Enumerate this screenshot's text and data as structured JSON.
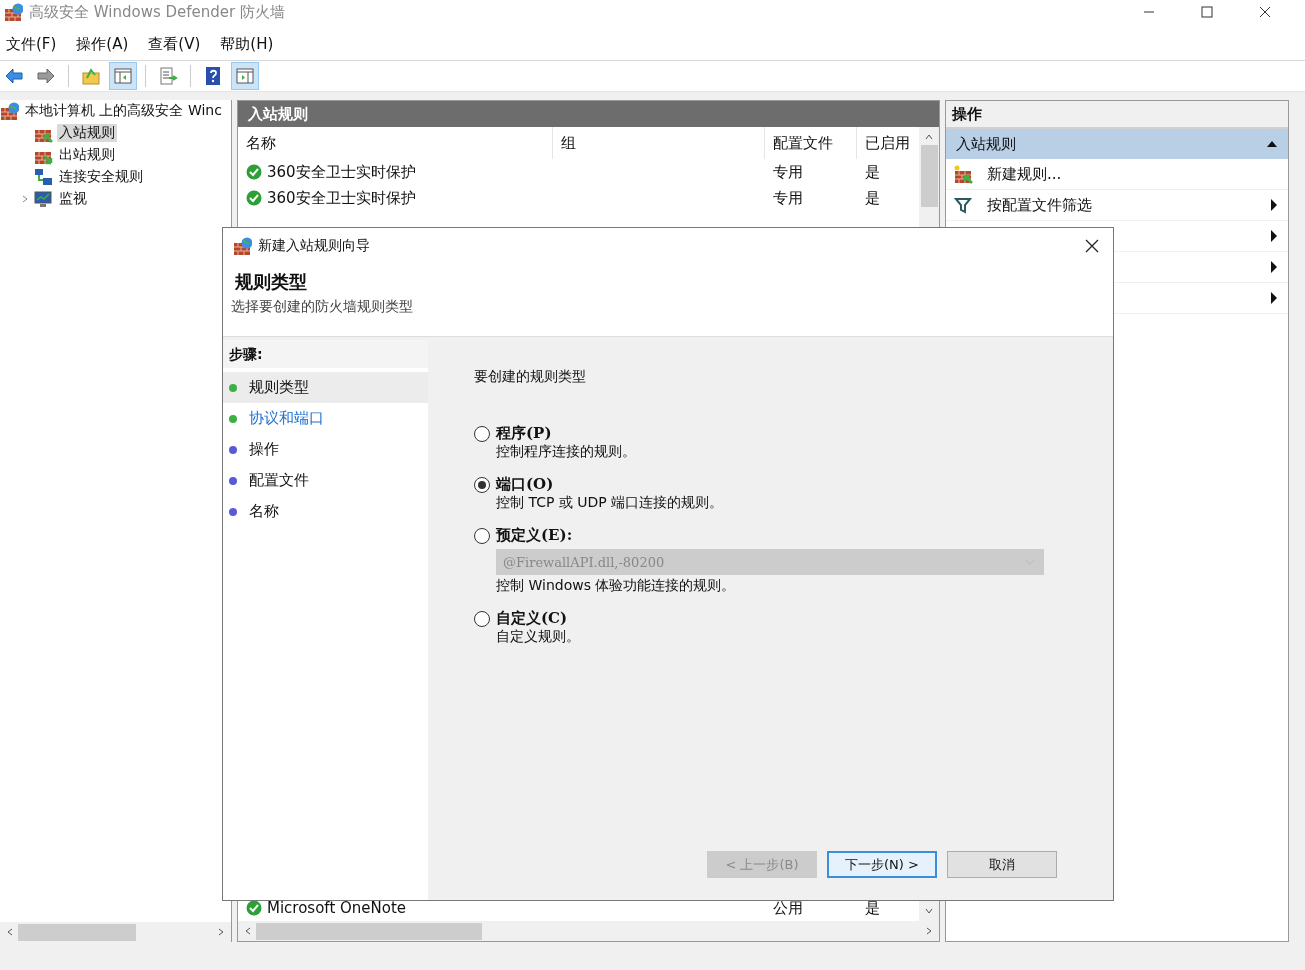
{
  "window": {
    "title": "高级安全 Windows Defender 防火墙"
  },
  "menu": [
    "文件(F)",
    "操作(A)",
    "查看(V)",
    "帮助(H)"
  ],
  "toolbar": [
    {
      "kind": "button",
      "pressed": false
    },
    {
      "kind": "button",
      "pressed": false
    },
    {
      "kind": "separator"
    },
    {
      "kind": "button",
      "pressed": false
    },
    {
      "kind": "button",
      "pressed": true
    },
    {
      "kind": "separator"
    },
    {
      "kind": "button",
      "pressed": false
    },
    {
      "kind": "separator"
    },
    {
      "kind": "button",
      "pressed": false
    },
    {
      "kind": "button",
      "pressed": true
    }
  ],
  "tree": [
    {
      "label": "本地计算机 上的高级安全 Winc",
      "selected": false,
      "children": [
        {
          "label": "入站规则",
          "selected": true
        },
        {
          "label": "出站规则",
          "selected": false
        },
        {
          "label": "连接安全规则",
          "selected": false
        },
        {
          "label": "监视",
          "selected": false,
          "expanded": false
        }
      ]
    }
  ],
  "center": {
    "title": "入站规则",
    "columns": [
      "名称",
      "组",
      "配置文件",
      "已启用"
    ],
    "rows": [
      {
        "cells": [
          "360安全卫士实时保护",
          "",
          "专用",
          "是"
        ]
      },
      {
        "cells": [
          "360安全卫士实时保护",
          "",
          "专用",
          "是"
        ]
      },
      {
        "cells": [
          "Microsoft OneNote",
          "",
          "公用",
          "是"
        ]
      }
    ]
  },
  "actions": {
    "title": "操作",
    "section": "入站规则",
    "expanded": true,
    "items": [
      {
        "label": "新建规则...",
        "submenu": false
      },
      {
        "label": "按配置文件筛选",
        "submenu": true
      },
      {
        "submenu": true
      },
      {
        "submenu": true
      },
      {
        "submenu": true
      }
    ]
  },
  "dialog": {
    "title": "新建入站规则向导",
    "heading": "规则类型",
    "subtitle": "选择要创建的防火墙规则类型",
    "steps_title": "步骤:",
    "steps": [
      {
        "label": "规则类型",
        "color": "#3cb043",
        "selected": true,
        "link": false
      },
      {
        "label": "协议和端口",
        "color": "#3cb043",
        "selected": false,
        "link": true
      },
      {
        "label": "操作",
        "color": "#5a5ad8",
        "selected": false,
        "link": false
      },
      {
        "label": "配置文件",
        "color": "#5a5ad8",
        "selected": false,
        "link": false
      },
      {
        "label": "名称",
        "color": "#5a5ad8",
        "selected": false,
        "link": false
      }
    ],
    "prompt": "要创建的规则类型",
    "options": [
      {
        "label": "程序(P)",
        "description": "控制程序连接的规则。",
        "selected": false
      },
      {
        "label": "端口(O)",
        "description": "控制 TCP 或 UDP 端口连接的规则。",
        "selected": true
      },
      {
        "label": "预定义(E):",
        "dropdown": {
          "value": "@FirewallAPI.dll,-80200",
          "disabled": true
        },
        "description": "控制 Windows 体验功能连接的规则。",
        "selected": false
      },
      {
        "label": "自定义(C)",
        "description": "自定义规则。",
        "selected": false
      }
    ],
    "buttons": [
      {
        "label": "< 上一步(B)",
        "disabled": true,
        "default": false
      },
      {
        "label": "下一步(N) >",
        "disabled": false,
        "default": true
      },
      {
        "label": "取消",
        "disabled": false,
        "default": false
      }
    ]
  }
}
